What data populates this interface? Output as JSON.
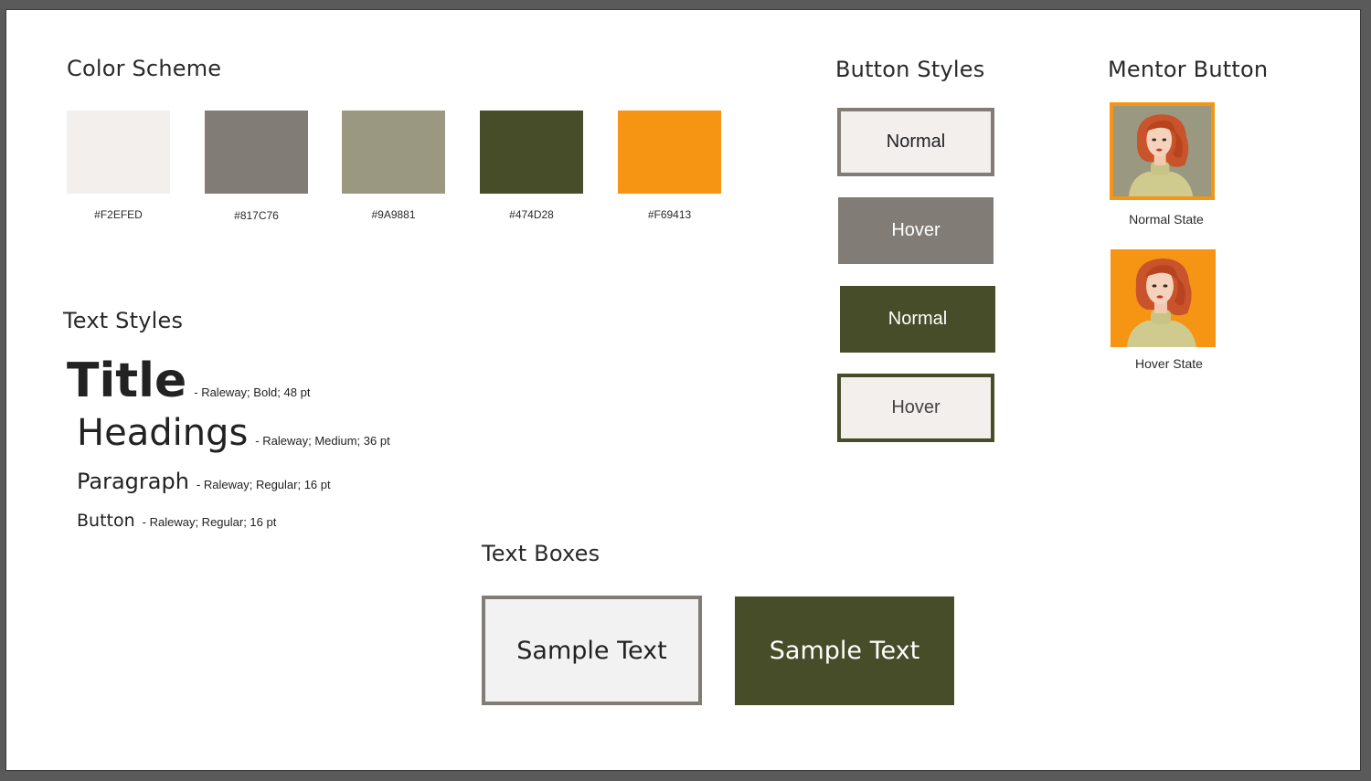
{
  "color_scheme": {
    "title": "Color Scheme",
    "swatches": [
      {
        "hex": "#F2EFED",
        "label": "#F2EFED"
      },
      {
        "hex": "#817C76",
        "label": "#817C76"
      },
      {
        "hex": "#9A9881",
        "label": "#9A9881"
      },
      {
        "hex": "#474D28",
        "label": "#474D28"
      },
      {
        "hex": "#F69413",
        "label": "#F69413"
      }
    ]
  },
  "button_styles": {
    "title": "Button Styles",
    "buttons": [
      {
        "label": "Normal"
      },
      {
        "label": "Hover"
      },
      {
        "label": "Normal"
      },
      {
        "label": "Hover"
      }
    ]
  },
  "mentor_button": {
    "title": "Mentor Button",
    "normal_caption": "Normal State",
    "hover_caption": "Hover State"
  },
  "text_styles": {
    "title": "Text Styles",
    "items": [
      {
        "sample": "Title",
        "note": "- Raleway; Bold; 48 pt"
      },
      {
        "sample": "Headings",
        "note": "- Raleway; Medium; 36 pt"
      },
      {
        "sample": "Paragraph",
        "note": "- Raleway; Regular; 16 pt"
      },
      {
        "sample": "Button",
        "note": "- Raleway; Regular; 16 pt"
      }
    ]
  },
  "text_boxes": {
    "title": "Text Boxes",
    "boxes": [
      {
        "text": "Sample Text"
      },
      {
        "text": "Sample Text"
      }
    ]
  },
  "colors": {
    "light": "#F2EFED",
    "gray": "#817C76",
    "sage": "#9A9881",
    "olive": "#474D28",
    "orange": "#F69413"
  }
}
